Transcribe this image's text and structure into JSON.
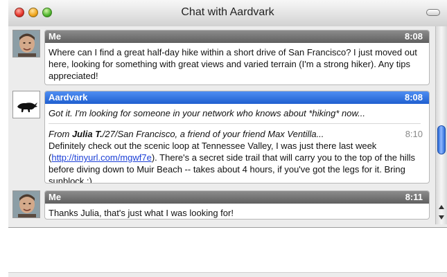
{
  "window": {
    "title": "Chat with Aardvark"
  },
  "messages": [
    {
      "sender": "Me",
      "time": "8:08",
      "text": "Where can I find a great half-day hike within a short drive of San Francisco?  I just moved out here, looking for something with great views and varied terrain (I'm a strong hiker).  Any tips appreciated!"
    },
    {
      "sender": "Aardvark",
      "time": "8:08",
      "line1": "Got it.  I'm looking for someone in your network who knows about *hiking* now...",
      "reply": {
        "prefix": "From ",
        "name": "Julia T.",
        "detail": "/27/San Francisco, a friend of your friend Max Ventilla...",
        "time": "8:10",
        "text_before_link": "Definitely check out the scenic loop at Tennessee Valley, I was just there last week (",
        "link": "http://tinyurl.com/mgwf7e",
        "text_after_link": ").  There's a secret side trail that will carry you to the top of the hills before diving down to Muir Beach -- takes about 4 hours, if you've got the legs for it.  Bring sunblock :)"
      }
    },
    {
      "sender": "Me",
      "time": "8:11",
      "text": "Thanks Julia, that's just what I was looking for!"
    }
  ],
  "input": {
    "value": ""
  },
  "colors": {
    "header_me": "#6f6f6f",
    "header_aardvark": "#2f6fe0",
    "link": "#1b3fd6"
  },
  "icons": [
    "user-avatar",
    "aardvark-icon",
    "scroll-up-icon",
    "scroll-down-icon"
  ]
}
